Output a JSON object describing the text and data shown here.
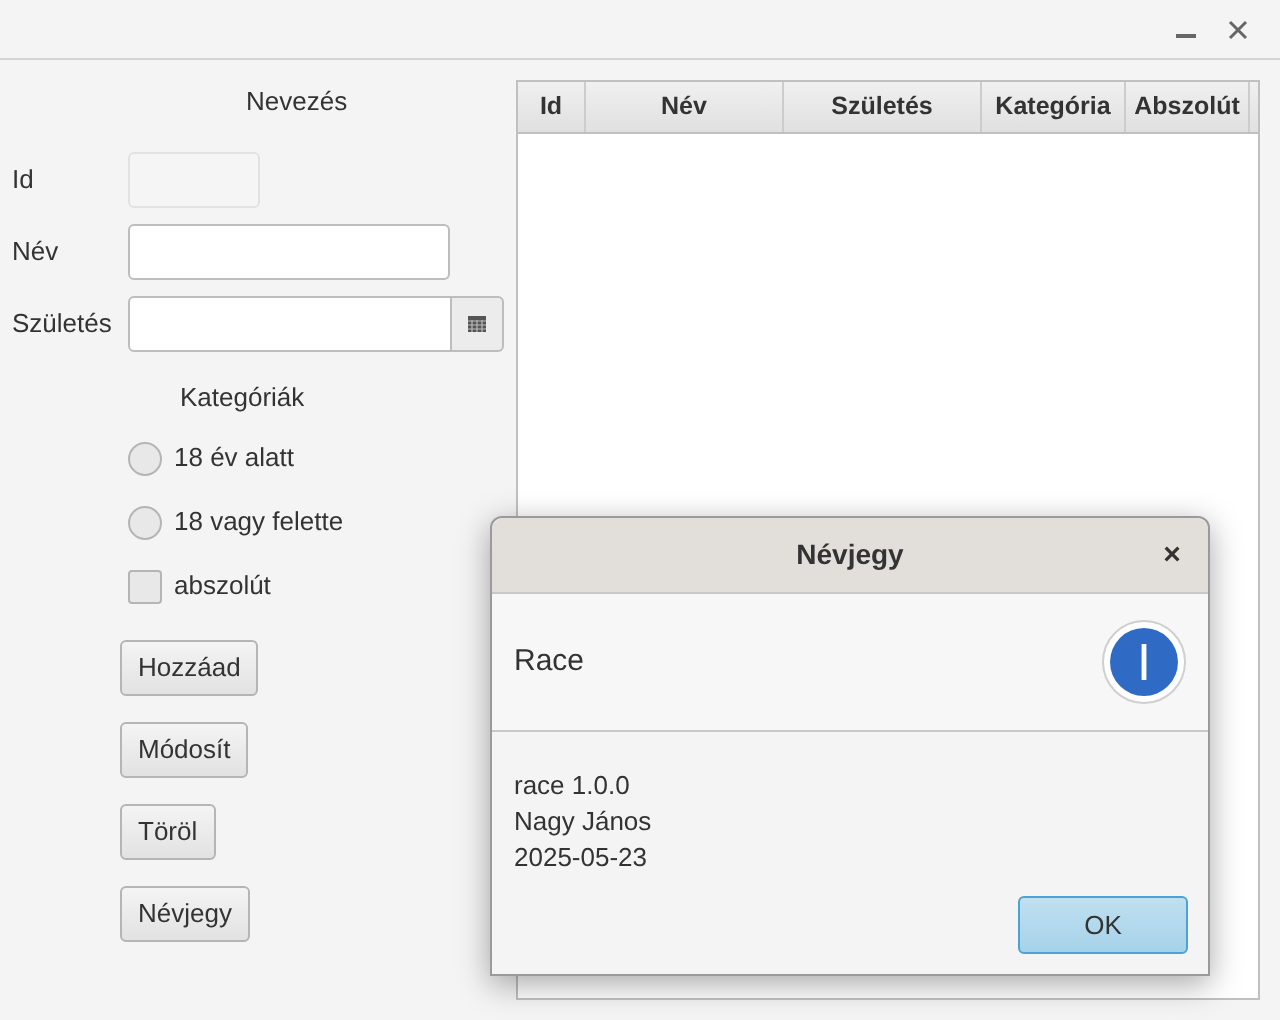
{
  "form": {
    "title": "Nevezés",
    "fields": [
      {
        "label": "Id",
        "kind": "text",
        "disabled": true
      },
      {
        "label": "Név",
        "kind": "text",
        "disabled": false
      },
      {
        "label": "Születés",
        "kind": "date",
        "disabled": false
      }
    ],
    "categories_title": "Kategóriák",
    "options": [
      {
        "kind": "radio",
        "label": "18 év alatt",
        "selected": false
      },
      {
        "kind": "radio",
        "label": "18 vagy felette",
        "selected": false
      },
      {
        "kind": "checkbox",
        "label": "abszolút",
        "checked": false
      }
    ],
    "buttons": [
      "Hozzáad",
      "Módosít",
      "Töröl",
      "Névjegy"
    ]
  },
  "table": {
    "columns": [
      "Id",
      "Név",
      "Születés",
      "Kategória",
      "Abszolút"
    ]
  },
  "dialog": {
    "title": "Névjegy",
    "close": "×",
    "header": "Race",
    "lines": [
      "race 1.0.0",
      "Nagy János",
      "2025-05-23"
    ],
    "button": "OK"
  }
}
